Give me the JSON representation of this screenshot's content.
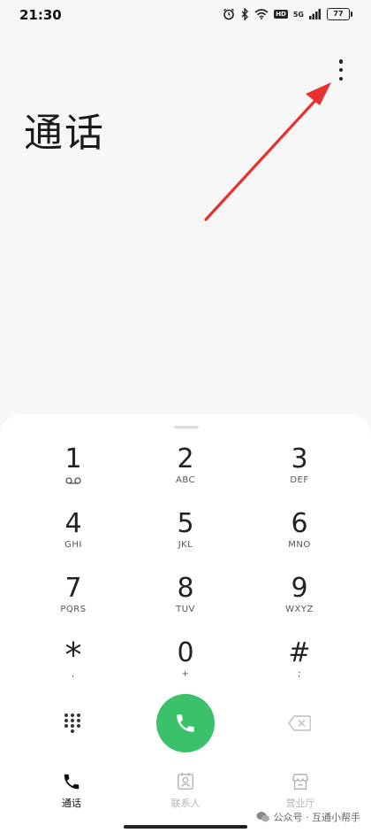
{
  "status_bar": {
    "time": "21:30",
    "battery": "77",
    "network_badge": "HD",
    "signal_badge": "5G"
  },
  "header": {
    "title": "通话",
    "more_icon": "more-vertical-icon"
  },
  "dialer": {
    "keys": [
      {
        "digit": "1",
        "letters": ""
      },
      {
        "digit": "2",
        "letters": "ABC"
      },
      {
        "digit": "3",
        "letters": "DEF"
      },
      {
        "digit": "4",
        "letters": "GHI"
      },
      {
        "digit": "5",
        "letters": "JKL"
      },
      {
        "digit": "6",
        "letters": "MNO"
      },
      {
        "digit": "7",
        "letters": "PQRS"
      },
      {
        "digit": "8",
        "letters": "TUV"
      },
      {
        "digit": "9",
        "letters": "WXYZ"
      },
      {
        "digit": "*",
        "letters": ","
      },
      {
        "digit": "0",
        "letters": "+"
      },
      {
        "digit": "#",
        "letters": ";"
      }
    ],
    "call_color": "#3cc16b"
  },
  "nav": {
    "items": [
      {
        "label": "通话",
        "active": true
      },
      {
        "label": "联系人",
        "active": false
      },
      {
        "label": "营业厅",
        "active": false
      }
    ]
  },
  "watermark": {
    "text": "公众号 · 互通小帮手"
  }
}
